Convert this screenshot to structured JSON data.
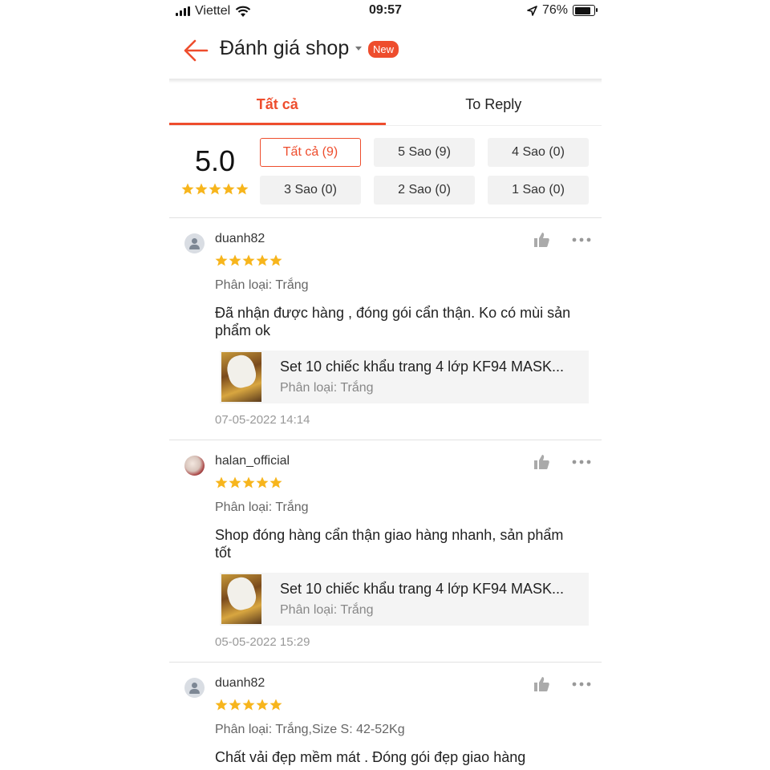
{
  "status_bar": {
    "carrier": "Viettel",
    "time": "09:57",
    "battery": "76%"
  },
  "header": {
    "title": "Đánh giá shop",
    "badge": "New"
  },
  "tabs": [
    {
      "label": "Tất cả"
    },
    {
      "label": "To Reply"
    }
  ],
  "summary": {
    "score": "5.0",
    "rating_stars": 5
  },
  "filters": [
    {
      "label": "Tất cả (9)"
    },
    {
      "label": "5 Sao (9)"
    },
    {
      "label": "4 Sao (0)"
    },
    {
      "label": "3 Sao (0)"
    },
    {
      "label": "2 Sao (0)"
    },
    {
      "label": "1 Sao (0)"
    }
  ],
  "colors": {
    "accent": "#ee4d2d",
    "star": "#f7b51c"
  },
  "icons": {
    "back": "arrow-left-icon",
    "like": "thumbs-up-icon",
    "more": "more-dots-icon",
    "avatar": "user-avatar-icon"
  },
  "reviews": [
    {
      "username": "duanh82",
      "stars": 5,
      "variant": "Phân loại: Trắng",
      "text_lines": [
        "Đã nhận được hàng , đóng gói cẩn thận. Ko có mùi sản",
        "phẩm ok"
      ],
      "product": {
        "title": "Set 10 chiếc khẩu trang 4 lớp KF94 MASK...",
        "variant": "Phân loại: Trắng"
      },
      "date": "07-05-2022 14:14"
    },
    {
      "username": "halan_official",
      "stars": 5,
      "variant": "Phân loại: Trắng",
      "text_lines": [
        "Shop đóng hàng cẩn thận giao hàng nhanh, sản phẩm",
        "tốt"
      ],
      "product": {
        "title": "Set 10 chiếc khẩu trang 4 lớp KF94 MASK...",
        "variant": "Phân loại: Trắng"
      },
      "date": "05-05-2022 15:29"
    },
    {
      "username": "duanh82",
      "stars": 5,
      "variant": "Phân loại: Trắng,Size S: 42-52Kg",
      "text_lines": [
        "Chất vải đẹp mềm mát . Đóng gói đẹp giao hàng"
      ]
    }
  ]
}
